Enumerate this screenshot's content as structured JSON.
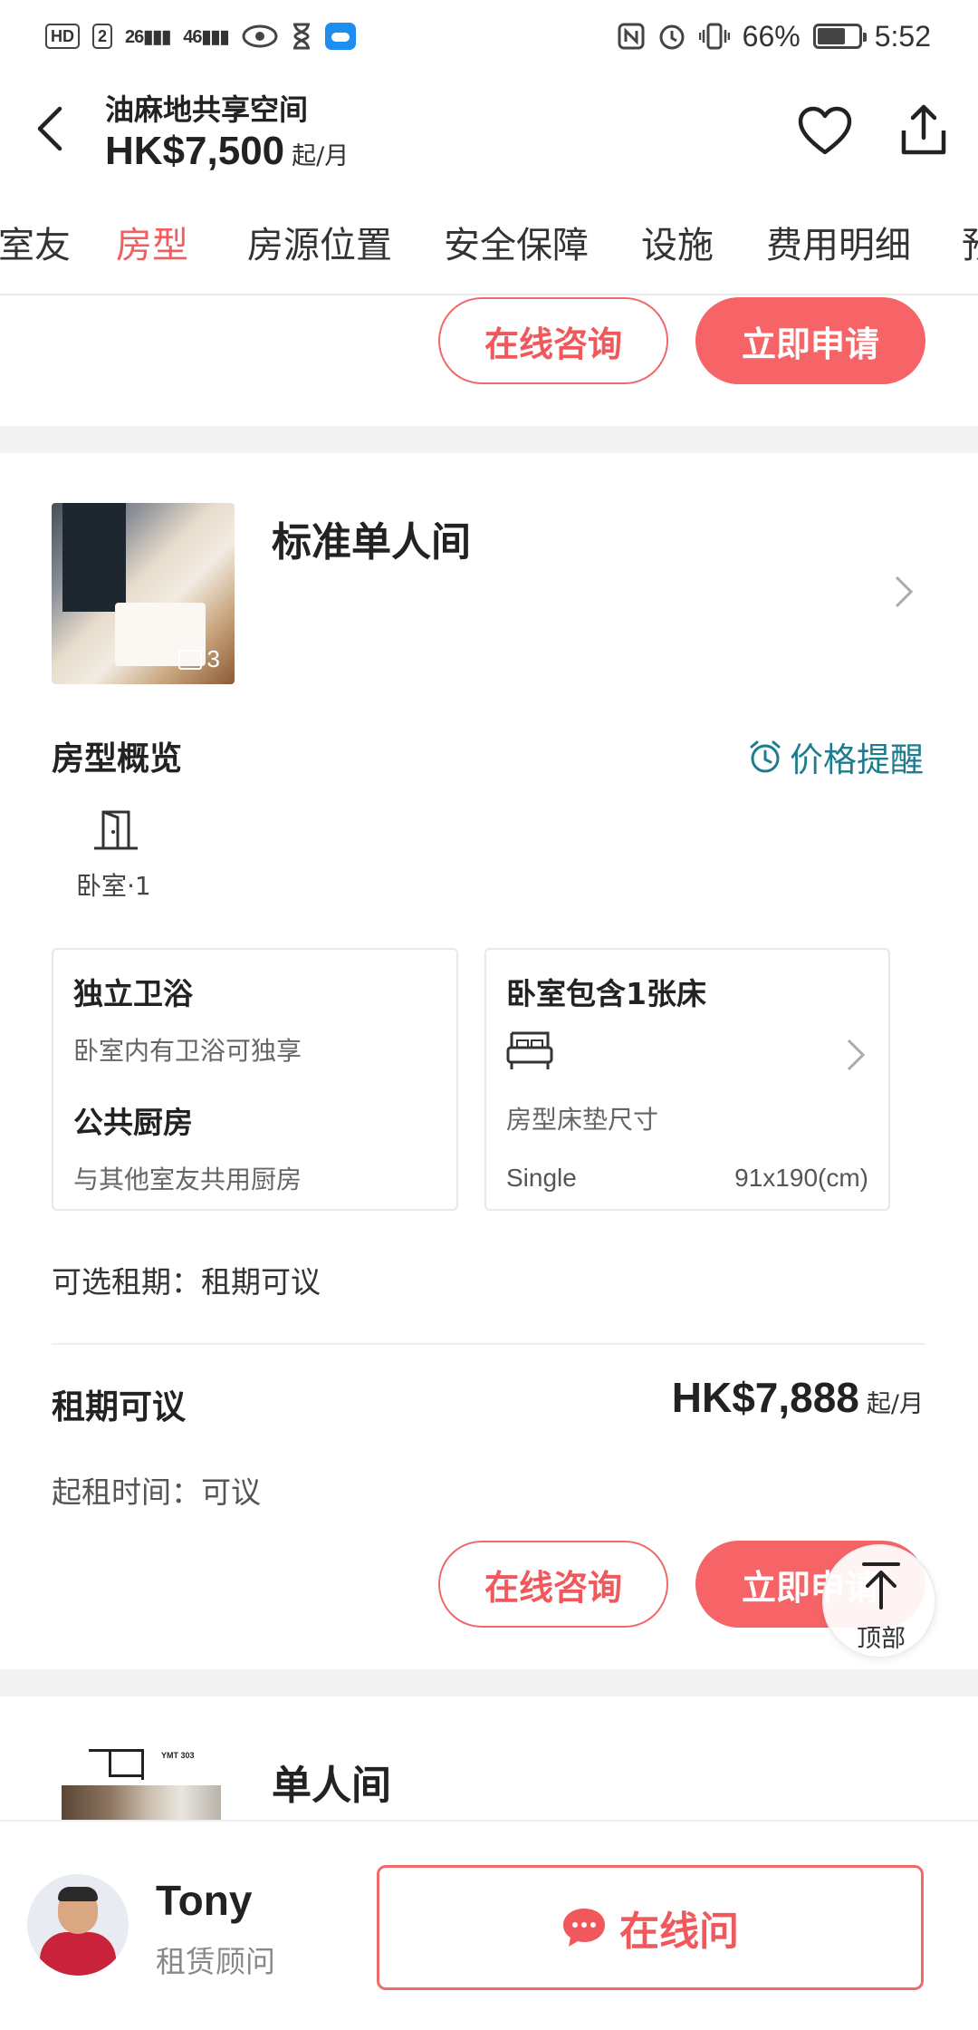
{
  "status_bar": {
    "hd_badge": "HD",
    "sim_badge": "2",
    "signal_1": "26",
    "signal_2": "46",
    "battery_percent": "66%",
    "time": "5:52"
  },
  "header": {
    "title": "油麻地共享空间",
    "price": "HK$7,500",
    "price_unit": "起/月"
  },
  "tabs": [
    {
      "label": "室友"
    },
    {
      "label": "房型",
      "active": true
    },
    {
      "label": "房源位置"
    },
    {
      "label": "安全保障"
    },
    {
      "label": "设施"
    },
    {
      "label": "费用明细"
    },
    {
      "label": "预"
    }
  ],
  "actions": {
    "consult_label": "在线咨询",
    "apply_label": "立即申请"
  },
  "room": {
    "name": "标准单人间",
    "photo_count": "3",
    "overview_title": "房型概览",
    "price_alert_label": "价格提醒",
    "bedroom_label": "卧室·1",
    "bathroom": {
      "title": "独立卫浴",
      "desc": "卧室内有卫浴可独享"
    },
    "kitchen": {
      "title": "公共厨房",
      "desc": "与其他室友共用厨房"
    },
    "bed": {
      "title": "卧室包含1张床",
      "mattress_label": "房型床垫尺寸",
      "mattress_name": "Single",
      "mattress_size": "91x190(cm)"
    },
    "lease_options": "可选租期：租期可议",
    "lease": {
      "title": "租期可议",
      "price": "HK$7,888",
      "price_unit": "起/月",
      "start_time": "起租时间：可议"
    }
  },
  "top_button_label": "顶部",
  "room2": {
    "name": "单人间",
    "floorplan_label": "YMT 303"
  },
  "agent": {
    "name": "Tony",
    "role": "租赁顾问",
    "chat_label": "在线问"
  },
  "colors": {
    "accent": "#f25d5f",
    "teal": "#1d7d8f"
  }
}
